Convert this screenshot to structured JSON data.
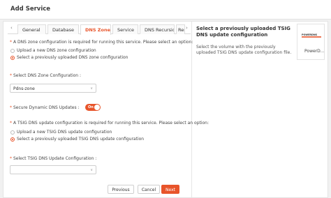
{
  "header": {
    "title": "Add Service"
  },
  "tabs": {
    "prev_arrow": "‹",
    "next_arrow": "›",
    "items": [
      {
        "label": "General"
      },
      {
        "label": "Database"
      },
      {
        "label": "DNS Zone",
        "active": true
      },
      {
        "label": "Service"
      },
      {
        "label": "DNS Recursion"
      },
      {
        "label": "Rem"
      }
    ]
  },
  "form": {
    "zone_config": {
      "required_mark": "*",
      "label": "A DNS zone configuration is required for running this service. Please select an option:",
      "options": [
        {
          "label": "Upload a new DNS zone configuration",
          "selected": false
        },
        {
          "label": "Select a previously uploaded DNS zone configuration",
          "selected": true
        }
      ]
    },
    "zone_select": {
      "required_mark": "*",
      "label": "Select DNS Zone Configuration :",
      "value": "Pdns-zone",
      "caret": "∨"
    },
    "secure_updates": {
      "required_mark": "*",
      "label": "Secure Dynamic DNS Updates :",
      "toggle_label": "On",
      "on": true
    },
    "tsig_config": {
      "required_mark": "*",
      "label": "A TSIG DNS update configuration is required for running this service. Please select an option:",
      "options": [
        {
          "label": "Upload a new TSIG DNS update configuration",
          "selected": false
        },
        {
          "label": "Select a previously uploaded TSIG DNS update configuration",
          "selected": true
        }
      ]
    },
    "tsig_select": {
      "required_mark": "*",
      "label": "Select TSIG DNS Update Configuration :",
      "value": "",
      "caret": "∨"
    }
  },
  "buttons": {
    "previous": "Previous",
    "cancel": "Cancel",
    "next": "Next"
  },
  "help": {
    "title": "Select a previously uploaded TSIG DNS update configuration",
    "text": "Select the volume with the previously uploaded TSIG DNS update configuration file.",
    "card_label": "PowerD…",
    "logo_text": "POWERDNS"
  },
  "colors": {
    "accent": "#e8542a",
    "background": "#f1f1f1"
  }
}
